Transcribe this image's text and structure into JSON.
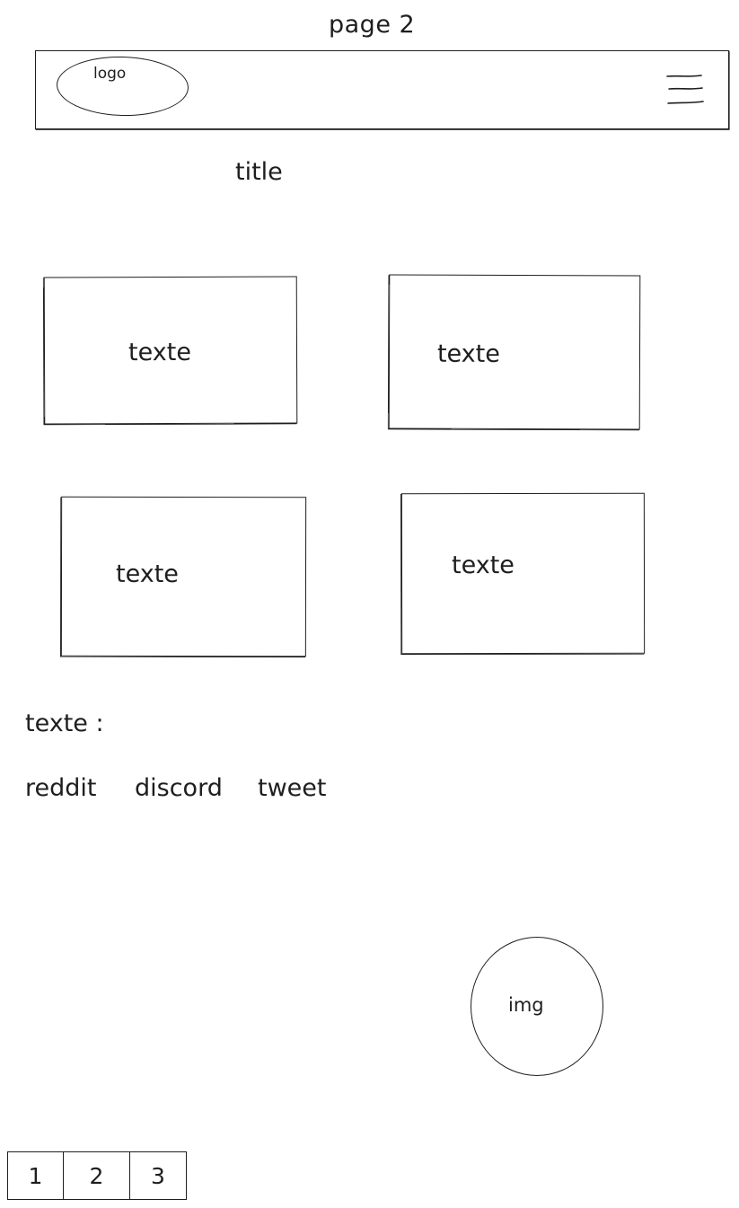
{
  "page_caption": "page 2",
  "header": {
    "logo_label": "logo",
    "menu_icon": "hamburger-menu-icon"
  },
  "main": {
    "title": "title",
    "cards": [
      {
        "label": "texte"
      },
      {
        "label": "texte"
      },
      {
        "label": "texte"
      },
      {
        "label": "texte"
      }
    ]
  },
  "footer": {
    "label": "texte :",
    "links": [
      "reddit",
      "discord",
      "tweet"
    ]
  },
  "image": {
    "label": "img"
  },
  "pagination": {
    "pages": [
      "1",
      "2",
      "3"
    ]
  },
  "colors": {
    "stroke": "#1e1e1e",
    "background": "#ffffff"
  }
}
